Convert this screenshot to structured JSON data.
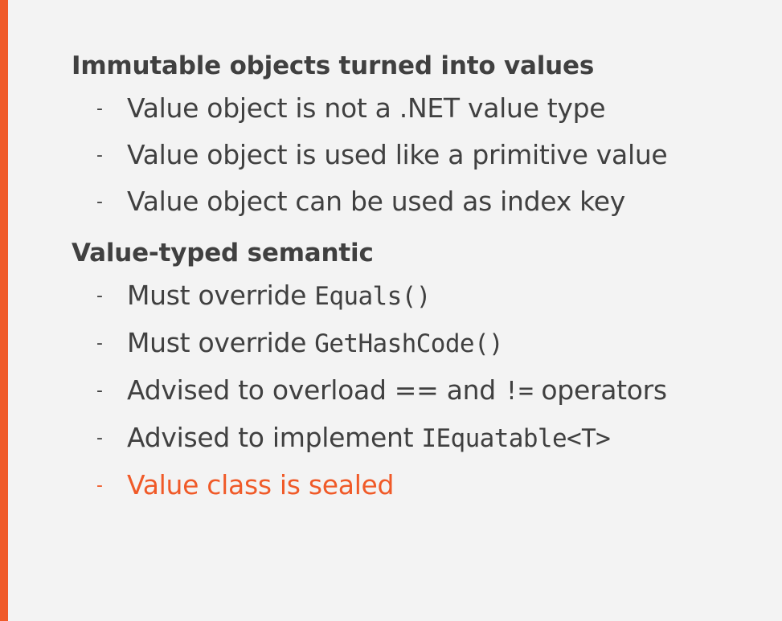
{
  "colors": {
    "accent": "#f05a28",
    "text": "#404040",
    "background": "#f3f3f3"
  },
  "sections": [
    {
      "heading": "Immutable objects turned into values",
      "items": [
        {
          "text": "Value object is not a .NET value type"
        },
        {
          "text": "Value object is used like a primitive value"
        },
        {
          "text": "Value object can be used as index key"
        }
      ]
    },
    {
      "heading": "Value-typed semantic",
      "items": [
        {
          "text": "Must override ",
          "code": "Equals()"
        },
        {
          "text": "Must override ",
          "code": "GetHashCode()"
        },
        {
          "text": "Advised to overload == and ",
          "code": "!=",
          "text_after": " operators"
        },
        {
          "text": "Advised to implement ",
          "code": "IEquatable<T>"
        },
        {
          "text": "Value class is sealed",
          "highlight": true
        }
      ]
    }
  ],
  "bullet_symbol": "-"
}
